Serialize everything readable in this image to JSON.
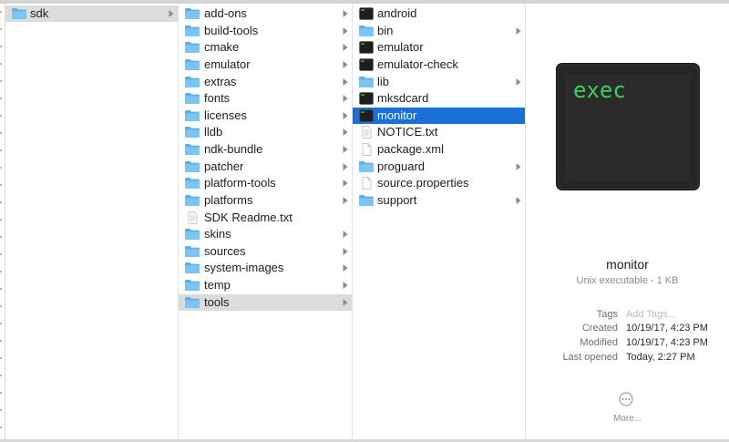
{
  "columns": [
    {
      "items": [
        {
          "label": "sdk",
          "kind": "folder",
          "chevron": true,
          "selected": "gray"
        }
      ]
    },
    {
      "items": [
        {
          "label": "add-ons",
          "kind": "folder",
          "chevron": true
        },
        {
          "label": "build-tools",
          "kind": "folder",
          "chevron": true
        },
        {
          "label": "cmake",
          "kind": "folder",
          "chevron": true
        },
        {
          "label": "emulator",
          "kind": "folder",
          "chevron": true
        },
        {
          "label": "extras",
          "kind": "folder",
          "chevron": true
        },
        {
          "label": "fonts",
          "kind": "folder",
          "chevron": true
        },
        {
          "label": "licenses",
          "kind": "folder",
          "chevron": true
        },
        {
          "label": "lldb",
          "kind": "folder",
          "chevron": true
        },
        {
          "label": "ndk-bundle",
          "kind": "folder",
          "chevron": true
        },
        {
          "label": "patcher",
          "kind": "folder",
          "chevron": true
        },
        {
          "label": "platform-tools",
          "kind": "folder",
          "chevron": true
        },
        {
          "label": "platforms",
          "kind": "folder",
          "chevron": true
        },
        {
          "label": "SDK Readme.txt",
          "kind": "text",
          "chevron": false
        },
        {
          "label": "skins",
          "kind": "folder",
          "chevron": true
        },
        {
          "label": "sources",
          "kind": "folder",
          "chevron": true
        },
        {
          "label": "system-images",
          "kind": "folder",
          "chevron": true
        },
        {
          "label": "temp",
          "kind": "folder",
          "chevron": true
        },
        {
          "label": "tools",
          "kind": "folder",
          "chevron": true,
          "selected": "gray"
        }
      ]
    },
    {
      "items": [
        {
          "label": "android",
          "kind": "exec",
          "chevron": false
        },
        {
          "label": "bin",
          "kind": "folder",
          "chevron": true
        },
        {
          "label": "emulator",
          "kind": "exec",
          "chevron": false
        },
        {
          "label": "emulator-check",
          "kind": "exec",
          "chevron": false
        },
        {
          "label": "lib",
          "kind": "folder",
          "chevron": true
        },
        {
          "label": "mksdcard",
          "kind": "exec",
          "chevron": false
        },
        {
          "label": "monitor",
          "kind": "exec",
          "chevron": false,
          "selected": "blue"
        },
        {
          "label": "NOTICE.txt",
          "kind": "text",
          "chevron": false
        },
        {
          "label": "package.xml",
          "kind": "doc",
          "chevron": false
        },
        {
          "label": "proguard",
          "kind": "folder",
          "chevron": true
        },
        {
          "label": "source.properties",
          "kind": "doc",
          "chevron": false
        },
        {
          "label": "support",
          "kind": "folder",
          "chevron": true
        }
      ]
    }
  ],
  "preview": {
    "icon_text": "exec",
    "name": "monitor",
    "kind": "Unix executable - 1 KB",
    "meta": [
      {
        "key": "Tags",
        "value": "Add Tags...",
        "placeholder": true
      },
      {
        "key": "Created",
        "value": "10/19/17, 4:23 PM",
        "placeholder": false
      },
      {
        "key": "Modified",
        "value": "10/19/17, 4:23 PM",
        "placeholder": false
      },
      {
        "key": "Last opened",
        "value": "Today, 2:27 PM",
        "placeholder": false
      }
    ],
    "more_label": "More..."
  },
  "colors": {
    "selection_blue": "#1a6fd9",
    "selection_gray": "#dcdcdc",
    "folder_blue": "#6ab8ef",
    "exec_green": "#3ad05a"
  }
}
